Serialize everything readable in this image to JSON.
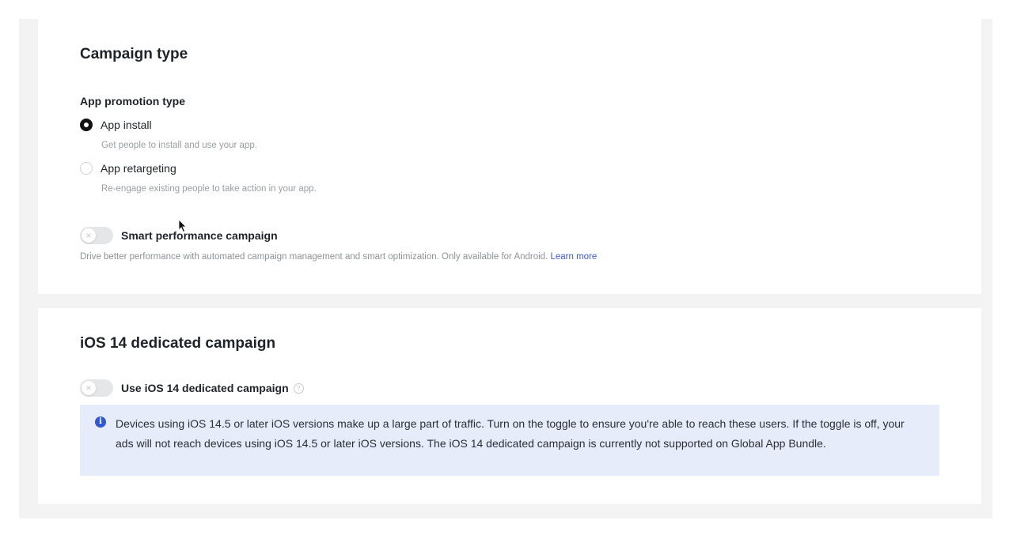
{
  "campaign_type": {
    "title": "Campaign type",
    "promotion_label": "App promotion type",
    "options": [
      {
        "label": "App install",
        "description": "Get people to install and use your app.",
        "selected": true
      },
      {
        "label": "App retargeting",
        "description": "Re-engage existing people to take action in your app.",
        "selected": false
      }
    ],
    "smart_toggle": {
      "label": "Smart performance campaign",
      "enabled": false,
      "description": "Drive better performance with automated campaign management and smart optimization. Only available for Android.",
      "learn_more": "Learn more"
    }
  },
  "ios_campaign": {
    "title": "iOS 14 dedicated campaign",
    "toggle": {
      "label": "Use iOS 14 dedicated campaign",
      "enabled": false
    },
    "info": "Devices using iOS 14.5 or later iOS versions make up a large part of traffic. Turn on the toggle to ensure you're able to reach these users. If the toggle is off, your ads will not reach devices using iOS 14.5 or later iOS versions. The iOS 14 dedicated campaign is currently not supported on Global App Bundle."
  },
  "colors": {
    "link": "#3b5bd9",
    "info_bg": "#e6ecfa",
    "info_icon": "#2f57d6"
  }
}
